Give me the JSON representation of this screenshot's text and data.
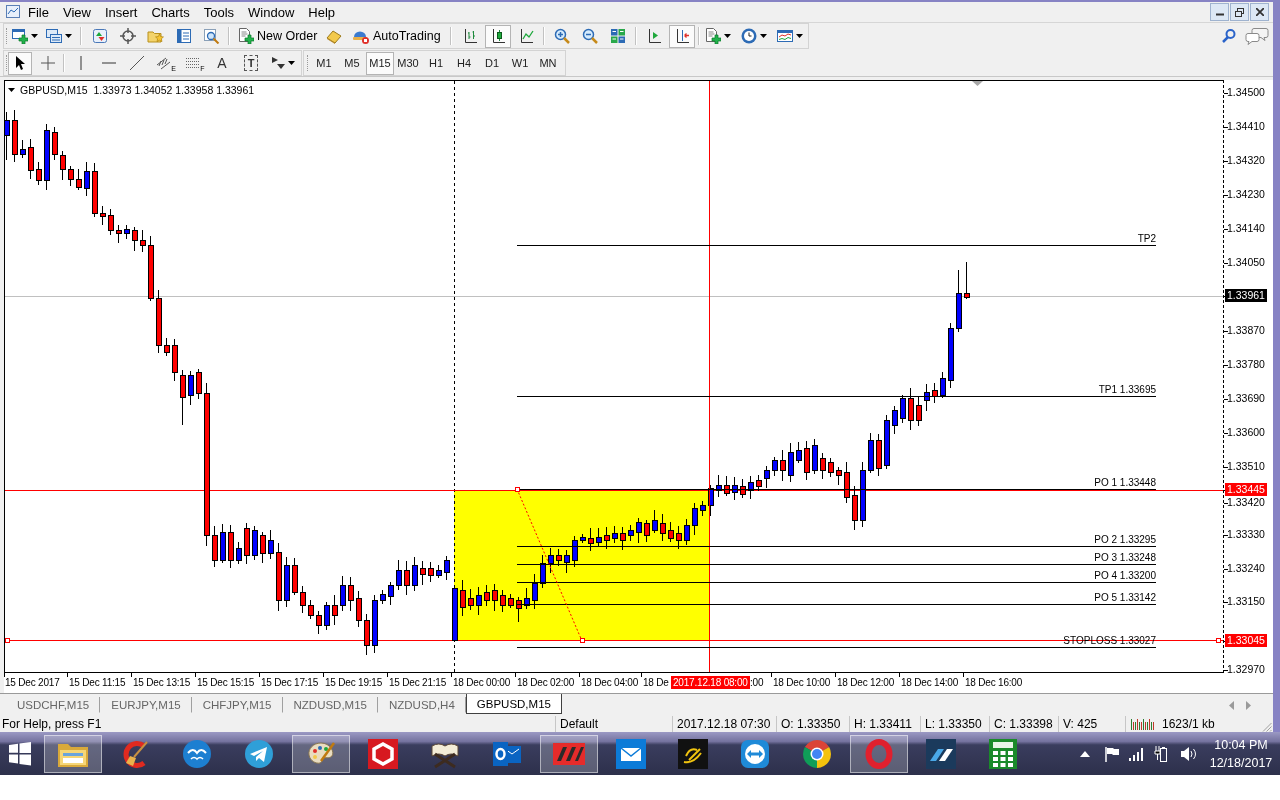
{
  "menu_bar": {
    "items": [
      "File",
      "View",
      "Insert",
      "Charts",
      "Tools",
      "Window",
      "Help"
    ]
  },
  "standard_toolbar": {
    "new_order": {
      "label": "New Order"
    },
    "auto_trading": {
      "label": "AutoTrading",
      "on": false
    },
    "chart_types": [
      {
        "kind": "bars",
        "selected": false
      },
      {
        "kind": "candles",
        "selected": true
      },
      {
        "kind": "line",
        "selected": false
      }
    ],
    "auto_scroll": {
      "on": false
    },
    "chart_shift": {
      "on": true
    }
  },
  "line_studies_toolbar": {
    "tools": [
      {
        "kind": "cursor",
        "selected": true
      },
      {
        "kind": "crosshair",
        "selected": false
      },
      {
        "kind": "vertical_line",
        "selected": false
      },
      {
        "kind": "horizontal_line",
        "selected": false
      },
      {
        "kind": "trendline",
        "selected": false
      },
      {
        "kind": "channel",
        "label": "E",
        "selected": false
      },
      {
        "kind": "fibonacci",
        "label": "F",
        "selected": false
      },
      {
        "kind": "text",
        "label": "A",
        "selected": false
      },
      {
        "kind": "label",
        "label": "T",
        "selected": false
      },
      {
        "kind": "arrows",
        "selected": false
      }
    ]
  },
  "periodicity_toolbar": {
    "timeframes": [
      {
        "label": "M1",
        "selected": false
      },
      {
        "label": "M5",
        "selected": false
      },
      {
        "label": "M15",
        "selected": true
      },
      {
        "label": "M30",
        "selected": false
      },
      {
        "label": "H1",
        "selected": false
      },
      {
        "label": "H4",
        "selected": false
      },
      {
        "label": "D1",
        "selected": false
      },
      {
        "label": "W1",
        "selected": false
      },
      {
        "label": "MN",
        "selected": false
      }
    ]
  },
  "chart": {
    "title": "GBPUSD,M15  1.33973 1.34052 1.33958 1.33961",
    "levels": [
      {
        "label": "TP2"
      },
      {
        "label": "TP1 1.33695"
      },
      {
        "label": "PO 1 1.33448"
      },
      {
        "label": "PO 2 1.33295"
      },
      {
        "label": "PO 3 1.33248"
      },
      {
        "label": "PO 4 1.33200"
      },
      {
        "label": "PO 5 1.33142"
      },
      {
        "label": "STOPLOSS 1.33027"
      }
    ],
    "price_scale": [
      {
        "label": "1.34500",
        "kind": "tick"
      },
      {
        "label": "1.34410",
        "kind": "tick"
      },
      {
        "label": "1.34320",
        "kind": "tick"
      },
      {
        "label": "1.34230",
        "kind": "tick"
      },
      {
        "label": "1.34140",
        "kind": "tick"
      },
      {
        "label": "1.34050",
        "kind": "tick"
      },
      {
        "label": "1.33961",
        "kind": "bid"
      },
      {
        "label": "1.33870",
        "kind": "tick"
      },
      {
        "label": "1.33780",
        "kind": "tick"
      },
      {
        "label": "1.33690",
        "kind": "tick"
      },
      {
        "label": "1.33600",
        "kind": "tick"
      },
      {
        "label": "1.33510",
        "kind": "tick"
      },
      {
        "label": "1.33445",
        "kind": "line"
      },
      {
        "label": "1.33420",
        "kind": "tick"
      },
      {
        "label": "1.33330",
        "kind": "tick"
      },
      {
        "label": "1.33240",
        "kind": "tick"
      },
      {
        "label": "1.33150",
        "kind": "tick"
      },
      {
        "label": "1.33045",
        "kind": "line"
      },
      {
        "label": "1.32970",
        "kind": "tick"
      }
    ],
    "time_scale": [
      {
        "label": "15 Dec 2017",
        "kind": "tick"
      },
      {
        "label": "15 Dec 11:15",
        "kind": "tick"
      },
      {
        "label": "15 Dec 13:15",
        "kind": "tick"
      },
      {
        "label": "15 Dec 15:15",
        "kind": "tick"
      },
      {
        "label": "15 Dec 17:15",
        "kind": "tick"
      },
      {
        "label": "15 Dec 19:15",
        "kind": "tick"
      },
      {
        "label": "15 Dec 21:15",
        "kind": "tick"
      },
      {
        "label": "18 Dec 00:00",
        "kind": "tick"
      },
      {
        "label": "18 Dec 02:00",
        "kind": "tick"
      },
      {
        "label": "18 Dec 04:00",
        "kind": "tick"
      },
      {
        "label": "18 De",
        "kind": "tick"
      },
      {
        "label": "2017.12.18 08:00",
        "kind": "cursor"
      },
      {
        "label": ":00",
        "kind": "tick"
      },
      {
        "label": "18 Dec 10:00",
        "kind": "tick"
      },
      {
        "label": "18 Dec 12:00",
        "kind": "tick"
      },
      {
        "label": "18 Dec 14:00",
        "kind": "tick"
      },
      {
        "label": "18 Dec 16:00",
        "kind": "tick"
      }
    ]
  },
  "chart_tabs": [
    {
      "label": "USDCHF,M15",
      "selected": false
    },
    {
      "label": "EURJPY,M15",
      "selected": false
    },
    {
      "label": "CHFJPY,M15",
      "selected": false
    },
    {
      "label": "NZDUSD,M15",
      "selected": false
    },
    {
      "label": "NZDUSD,H4",
      "selected": false
    },
    {
      "label": "GBPUSD,M15",
      "selected": true
    }
  ],
  "status_bar": {
    "sections": [
      "For Help, press F1",
      "Default",
      "2017.12.18 07:30",
      "O: 1.33350",
      "H: 1.33411",
      "L: 1.33350",
      "C: 1.33398",
      "V: 425"
    ],
    "traffic": "1623/1 kb"
  },
  "taskbar": {
    "apps": [
      {
        "kind": "folder",
        "running": true
      },
      {
        "kind": "broom",
        "running": false
      },
      {
        "kind": "gulls",
        "running": false
      },
      {
        "kind": "plane",
        "running": false
      },
      {
        "kind": "palette",
        "running": true
      },
      {
        "kind": "hexagon",
        "running": false
      },
      {
        "kind": "book",
        "running": false
      },
      {
        "kind": "mail_ring",
        "running": false
      },
      {
        "kind": "stripes",
        "running": true
      },
      {
        "kind": "envelope",
        "running": false
      },
      {
        "kind": "swoosh",
        "running": false
      },
      {
        "kind": "double_arrow",
        "running": false
      },
      {
        "kind": "segmented_circle",
        "running": false
      },
      {
        "kind": "ring",
        "running": true
      },
      {
        "kind": "slashes",
        "running": false
      },
      {
        "kind": "calculator",
        "running": false
      }
    ],
    "clock": {
      "time": "10:04 PM",
      "date": "12/18/2017"
    }
  }
}
